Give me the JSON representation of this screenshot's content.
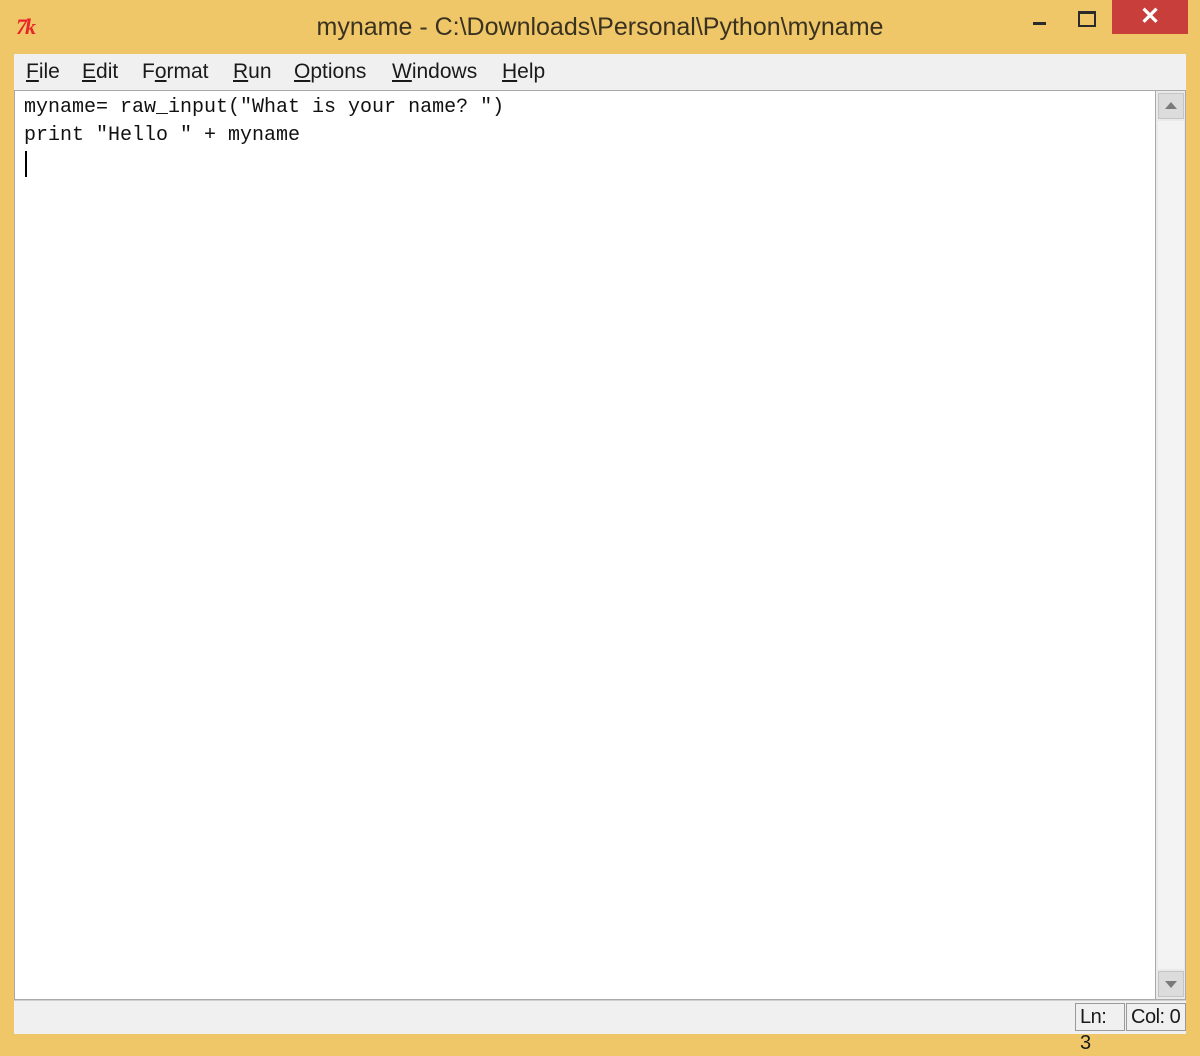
{
  "window": {
    "title": "myname - C:\\Downloads\\Personal\\Python\\myname",
    "app_icon_text": "7k",
    "buttons": {
      "minimize": "minimize",
      "maximize": "maximize",
      "close": "✕"
    }
  },
  "menu": {
    "items": [
      {
        "label": "File",
        "underline": "F",
        "rest": "ile"
      },
      {
        "label": "Edit",
        "underline": "E",
        "rest": "dit"
      },
      {
        "label": "Format",
        "pre": "F",
        "underline": "o",
        "rest": "rmat"
      },
      {
        "label": "Run",
        "underline": "R",
        "rest": "un"
      },
      {
        "label": "Options",
        "underline": "O",
        "rest": "ptions"
      },
      {
        "label": "Windows",
        "underline": "W",
        "rest": "indows"
      },
      {
        "label": "Help",
        "underline": "H",
        "rest": "elp"
      }
    ]
  },
  "editor": {
    "lines": [
      "myname= raw_input(\"What is your name? \")",
      "print \"Hello \" + myname"
    ]
  },
  "status": {
    "line": "Ln: 3",
    "column": "Col: 0"
  },
  "colors": {
    "frame": "#efc768",
    "close_button": "#c73e3a",
    "app_icon": "#e8262a"
  }
}
